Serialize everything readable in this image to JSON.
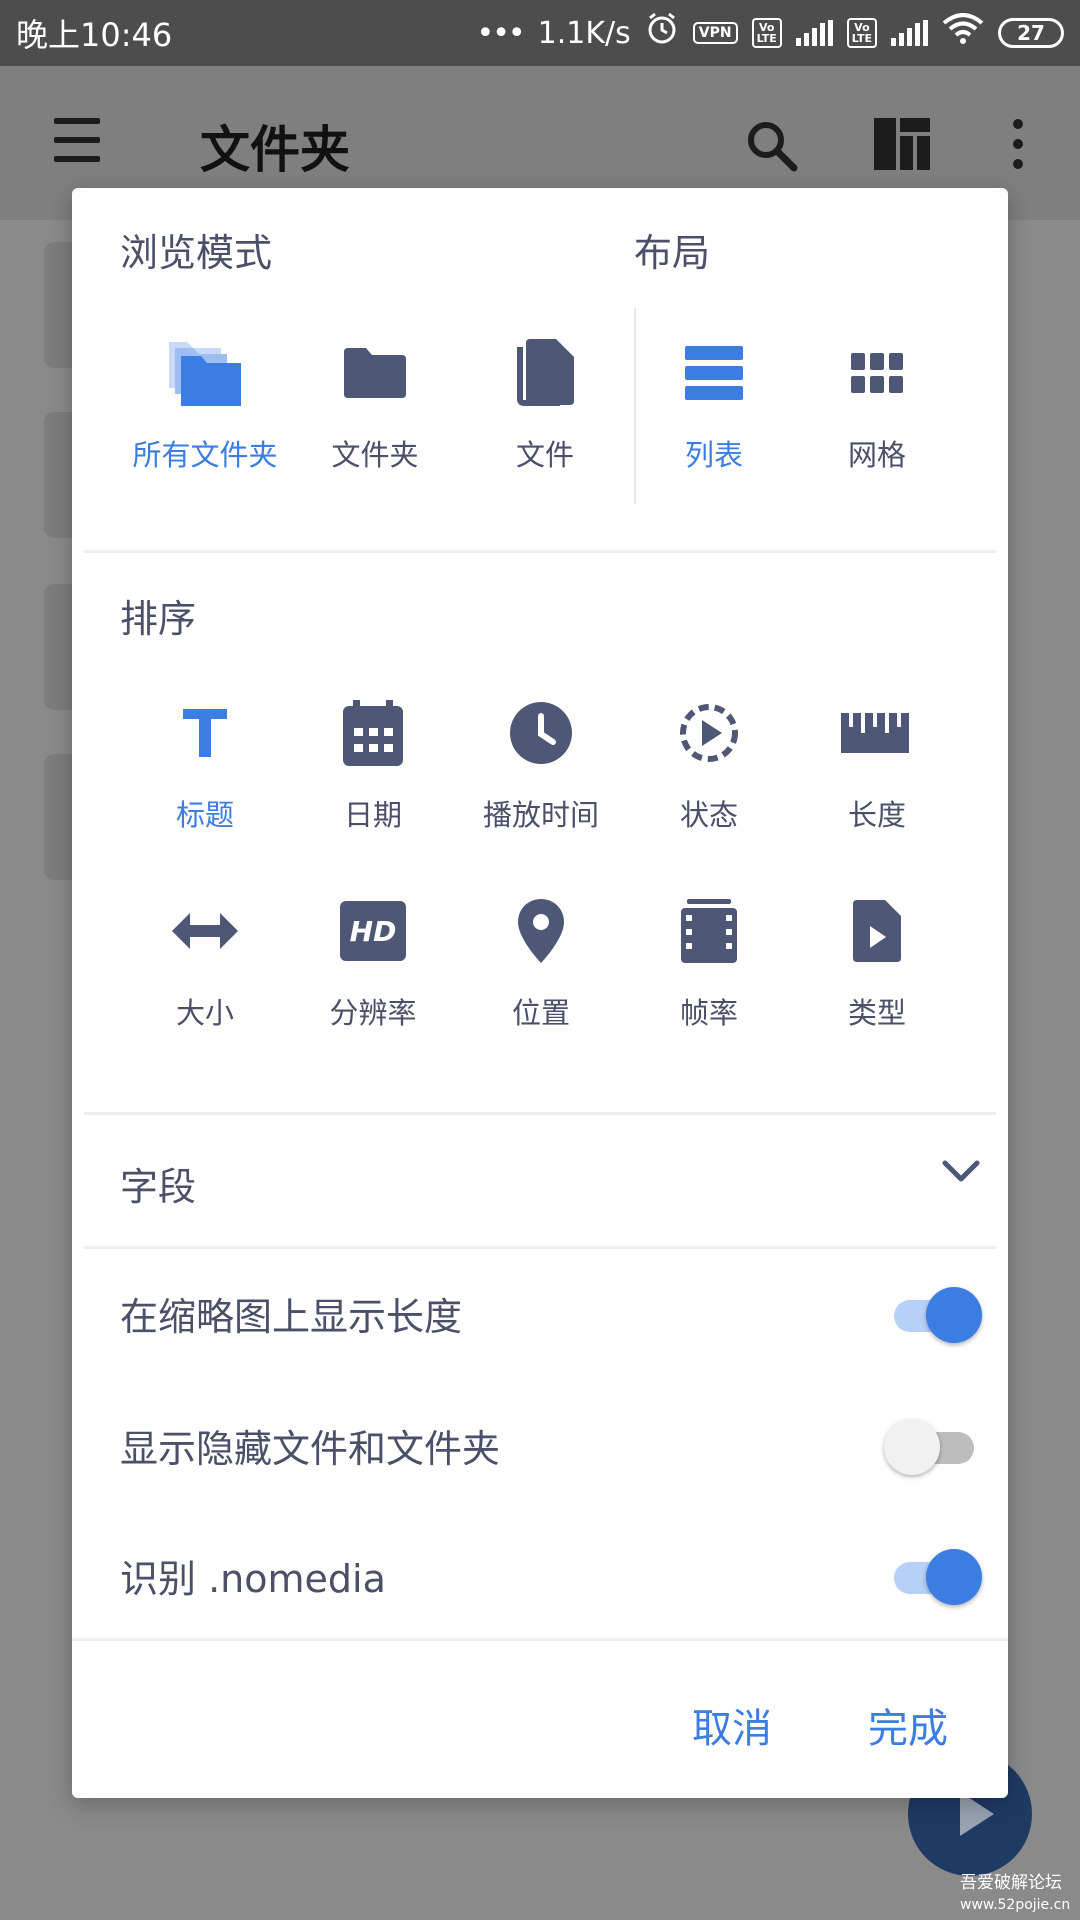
{
  "status_bar": {
    "time": "晚上10:46",
    "speed": "1.1K/s",
    "vpn": "VPN",
    "volte1": "Vo\nLTE",
    "volte2": "Vo\nLTE",
    "battery": "27"
  },
  "app_bar": {
    "title": "文件夹"
  },
  "dialog": {
    "browse_title": "浏览模式",
    "layout_title": "布局",
    "browse_modes": [
      {
        "label": "所有文件夹",
        "icon": "all-folders-icon",
        "active": true
      },
      {
        "label": "文件夹",
        "icon": "folder-icon",
        "active": false
      },
      {
        "label": "文件",
        "icon": "files-icon",
        "active": false
      }
    ],
    "layouts": [
      {
        "label": "列表",
        "icon": "list-icon",
        "active": true
      },
      {
        "label": "网格",
        "icon": "grid-icon",
        "active": false
      }
    ],
    "sort_title": "排序",
    "sort_options": [
      {
        "label": "标题",
        "icon": "title-icon",
        "active": true
      },
      {
        "label": "日期",
        "icon": "calendar-icon",
        "active": false
      },
      {
        "label": "播放时间",
        "icon": "clock-icon",
        "active": false
      },
      {
        "label": "状态",
        "icon": "status-icon",
        "active": false
      },
      {
        "label": "长度",
        "icon": "ruler-icon",
        "active": false
      },
      {
        "label": "大小",
        "icon": "size-icon",
        "active": false
      },
      {
        "label": "分辨率",
        "icon": "hd-icon",
        "active": false
      },
      {
        "label": "位置",
        "icon": "location-icon",
        "active": false
      },
      {
        "label": "帧率",
        "icon": "film-icon",
        "active": false
      },
      {
        "label": "类型",
        "icon": "file-type-icon",
        "active": false
      }
    ],
    "fields_title": "字段",
    "toggles": [
      {
        "label": "在缩略图上显示长度",
        "on": true
      },
      {
        "label": "显示隐藏文件和文件夹",
        "on": false
      },
      {
        "label": "识别 .nomedia",
        "on": true
      }
    ],
    "cancel_label": "取消",
    "done_label": "完成"
  },
  "watermark": {
    "line1": "吾爱破解论坛",
    "line2": "www.52pojie.cn"
  },
  "colors": {
    "accent": "#3b7de0",
    "icon": "#4e5775",
    "text": "#4a5068"
  }
}
